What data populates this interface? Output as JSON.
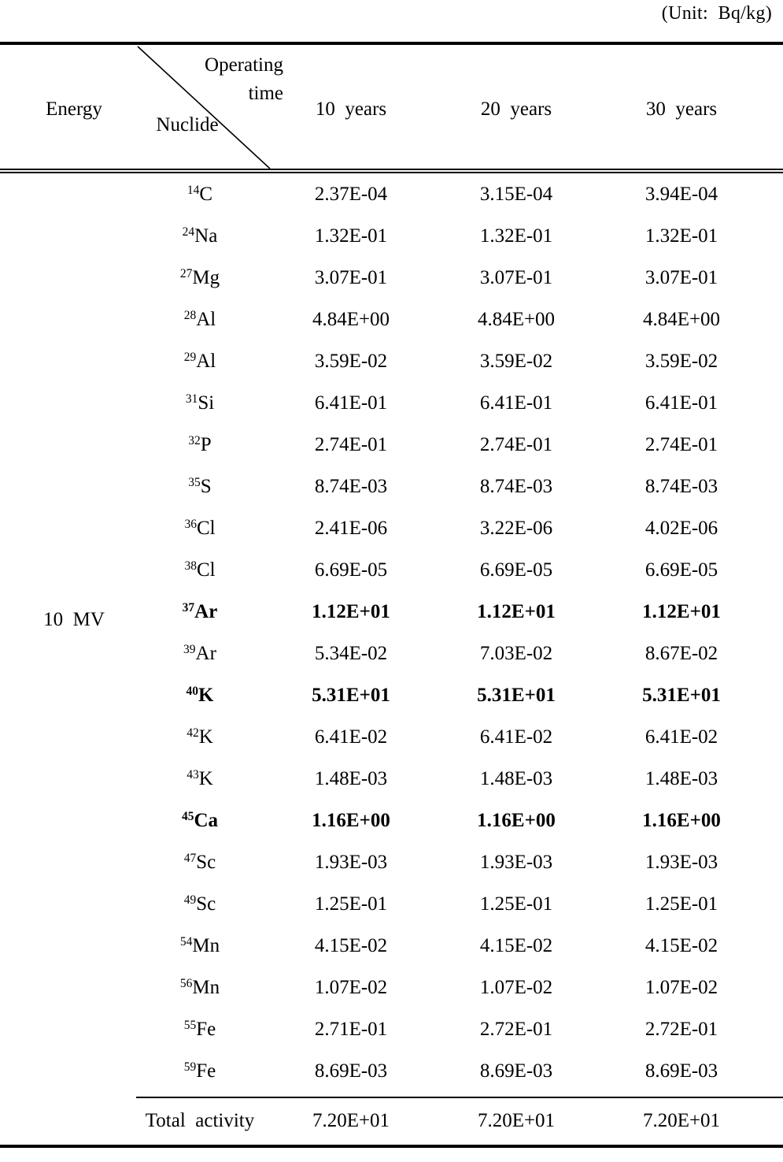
{
  "unit_caption": "(Unit:  Bq/kg)",
  "header": {
    "energy_label": "Energy",
    "operating_line1": "Operating",
    "operating_line2": "time",
    "nuclide_label": "Nuclide",
    "columns": [
      "10  years",
      "20  years",
      "30  years"
    ]
  },
  "energy_value": "10  MV",
  "rows": [
    {
      "mass": "14",
      "element": "C",
      "bold": false,
      "values": [
        "2.37E-04",
        "3.15E-04",
        "3.94E-04"
      ]
    },
    {
      "mass": "24",
      "element": "Na",
      "bold": false,
      "values": [
        "1.32E-01",
        "1.32E-01",
        "1.32E-01"
      ]
    },
    {
      "mass": "27",
      "element": "Mg",
      "bold": false,
      "values": [
        "3.07E-01",
        "3.07E-01",
        "3.07E-01"
      ]
    },
    {
      "mass": "28",
      "element": "Al",
      "bold": false,
      "values": [
        "4.84E+00",
        "4.84E+00",
        "4.84E+00"
      ]
    },
    {
      "mass": "29",
      "element": "Al",
      "bold": false,
      "values": [
        "3.59E-02",
        "3.59E-02",
        "3.59E-02"
      ]
    },
    {
      "mass": "31",
      "element": "Si",
      "bold": false,
      "values": [
        "6.41E-01",
        "6.41E-01",
        "6.41E-01"
      ]
    },
    {
      "mass": "32",
      "element": "P",
      "bold": false,
      "values": [
        "2.74E-01",
        "2.74E-01",
        "2.74E-01"
      ]
    },
    {
      "mass": "35",
      "element": "S",
      "bold": false,
      "values": [
        "8.74E-03",
        "8.74E-03",
        "8.74E-03"
      ]
    },
    {
      "mass": "36",
      "element": "Cl",
      "bold": false,
      "values": [
        "2.41E-06",
        "3.22E-06",
        "4.02E-06"
      ]
    },
    {
      "mass": "38",
      "element": "Cl",
      "bold": false,
      "values": [
        "6.69E-05",
        "6.69E-05",
        "6.69E-05"
      ]
    },
    {
      "mass": "37",
      "element": "Ar",
      "bold": true,
      "values": [
        "1.12E+01",
        "1.12E+01",
        "1.12E+01"
      ]
    },
    {
      "mass": "39",
      "element": "Ar",
      "bold": false,
      "values": [
        "5.34E-02",
        "7.03E-02",
        "8.67E-02"
      ]
    },
    {
      "mass": "40",
      "element": "K",
      "bold": true,
      "values": [
        "5.31E+01",
        "5.31E+01",
        "5.31E+01"
      ]
    },
    {
      "mass": "42",
      "element": "K",
      "bold": false,
      "values": [
        "6.41E-02",
        "6.41E-02",
        "6.41E-02"
      ]
    },
    {
      "mass": "43",
      "element": "K",
      "bold": false,
      "values": [
        "1.48E-03",
        "1.48E-03",
        "1.48E-03"
      ]
    },
    {
      "mass": "45",
      "element": "Ca",
      "bold": true,
      "values": [
        "1.16E+00",
        "1.16E+00",
        "1.16E+00"
      ]
    },
    {
      "mass": "47",
      "element": "Sc",
      "bold": false,
      "values": [
        "1.93E-03",
        "1.93E-03",
        "1.93E-03"
      ]
    },
    {
      "mass": "49",
      "element": "Sc",
      "bold": false,
      "values": [
        "1.25E-01",
        "1.25E-01",
        "1.25E-01"
      ]
    },
    {
      "mass": "54",
      "element": "Mn",
      "bold": false,
      "values": [
        "4.15E-02",
        "4.15E-02",
        "4.15E-02"
      ]
    },
    {
      "mass": "56",
      "element": "Mn",
      "bold": false,
      "values": [
        "1.07E-02",
        "1.07E-02",
        "1.07E-02"
      ]
    },
    {
      "mass": "55",
      "element": "Fe",
      "bold": false,
      "values": [
        "2.71E-01",
        "2.72E-01",
        "2.72E-01"
      ]
    },
    {
      "mass": "59",
      "element": "Fe",
      "bold": false,
      "values": [
        "8.69E-03",
        "8.69E-03",
        "8.69E-03"
      ]
    }
  ],
  "total": {
    "label": "Total  activity",
    "values": [
      "7.20E+01",
      "7.20E+01",
      "7.20E+01"
    ]
  }
}
